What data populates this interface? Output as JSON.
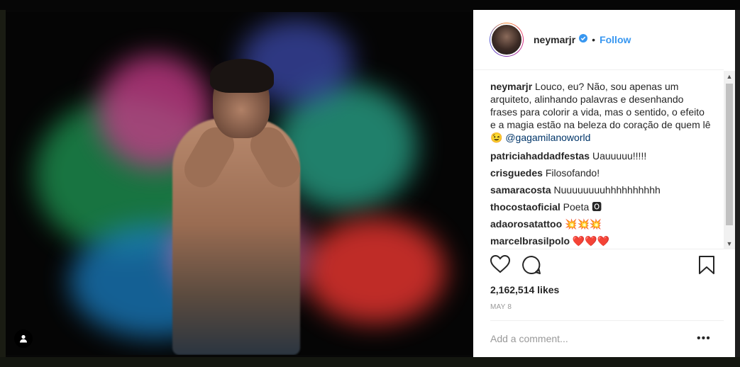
{
  "post": {
    "username": "neymarjr",
    "follow_label": "Follow",
    "dot": "•",
    "caption_user": "neymarjr",
    "caption_text": " Louco, eu? Não, sou apenas um arquiteto, alinhando palavras e desenhando frases para colorir a vida, mas o sentido, o efeito e a magia estão na beleza do coração de quem lê 😉 ",
    "caption_mention": "@gagamilanoworld",
    "likes": "2,162,514 likes",
    "date": "MAY 8",
    "add_comment_placeholder": "Add a comment...",
    "more": "•••"
  },
  "comments": [
    {
      "user": "patriciahaddadfestas",
      "text": " Uauuuuu!!!!!"
    },
    {
      "user": "crisguedes",
      "text": " Filosofando!"
    },
    {
      "user": "samaracosta",
      "text": " Nuuuuuuuuhhhhhhhhhh"
    },
    {
      "user": "thocostaoficial",
      "text": " Poeta 🅾"
    },
    {
      "user": "adaorosatattoo",
      "text": " 💥💥💥"
    },
    {
      "user": "marcelbrasilpolo",
      "text": " ❤️❤️❤️"
    }
  ],
  "colors": {
    "accent": "#3897f0",
    "verified": "#3897f0",
    "text": "#262626",
    "muted": "#999999"
  },
  "icons": [
    "user-tag-icon",
    "verified-icon",
    "heart-icon",
    "comment-icon",
    "bookmark-icon",
    "more-options-icon"
  ]
}
